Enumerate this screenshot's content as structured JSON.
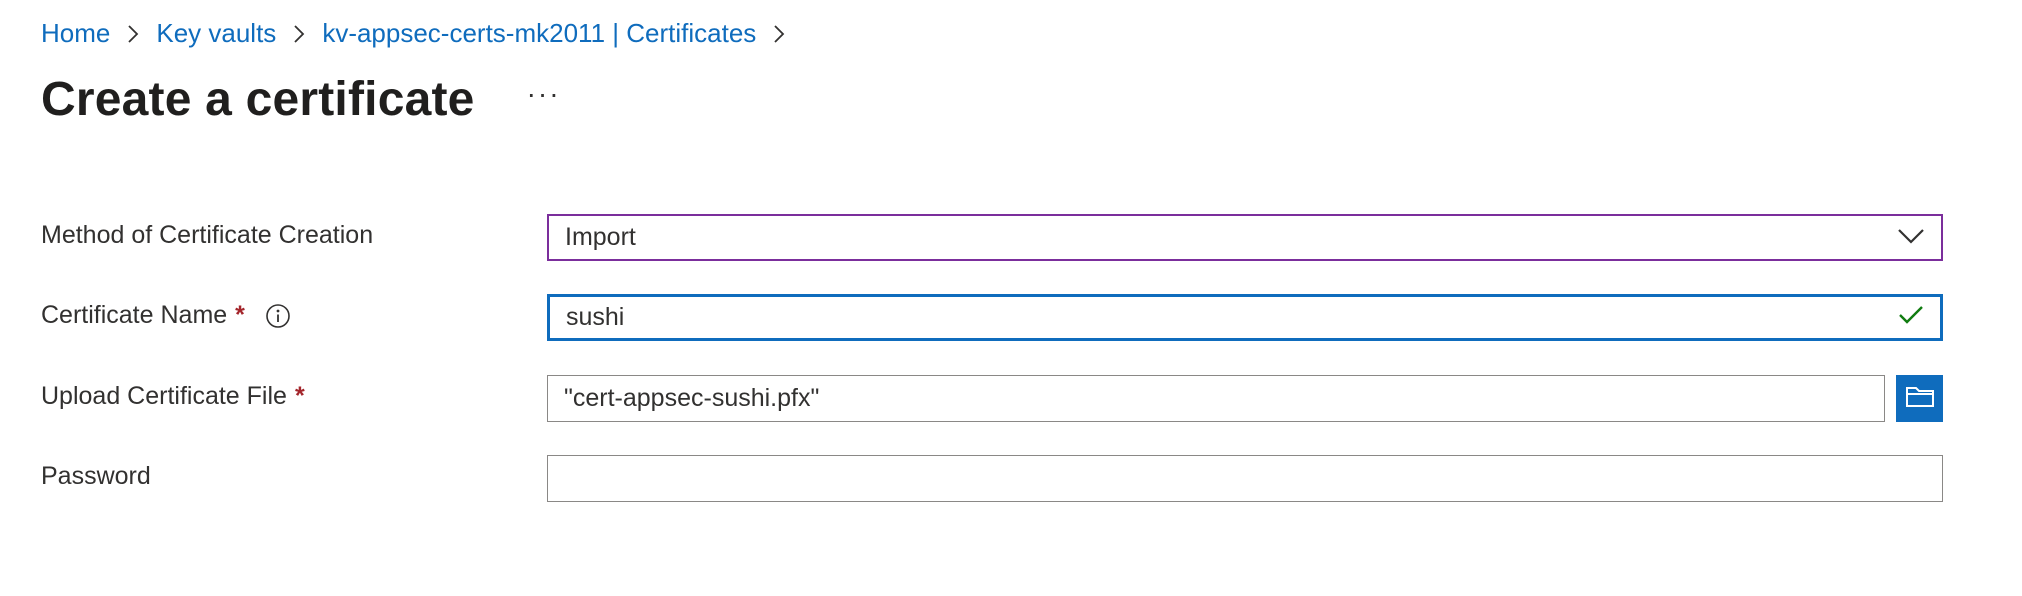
{
  "breadcrumb": {
    "items": [
      "Home",
      "Key vaults",
      "kv-appsec-certs-mk2011 | Certificates"
    ]
  },
  "page": {
    "title": "Create a certificate",
    "more_label": "···"
  },
  "form": {
    "method": {
      "label": "Method of Certificate Creation",
      "value": "Import"
    },
    "cert_name": {
      "label": "Certificate Name",
      "required_mark": "*",
      "value": "sushi",
      "valid": true
    },
    "upload": {
      "label": "Upload Certificate File",
      "required_mark": "*",
      "value": "\"cert-appsec-sushi.pfx\""
    },
    "password": {
      "label": "Password",
      "value": ""
    }
  },
  "colors": {
    "link": "#0f6cbd",
    "required": "#a4262c",
    "focus_border": "#0f6cbd",
    "select_border": "#7b2e9c",
    "valid_check": "#107c10"
  },
  "icons": [
    "chevron-right-icon",
    "ellipsis-icon",
    "info-icon",
    "chevron-down-icon",
    "checkmark-icon",
    "folder-icon"
  ]
}
